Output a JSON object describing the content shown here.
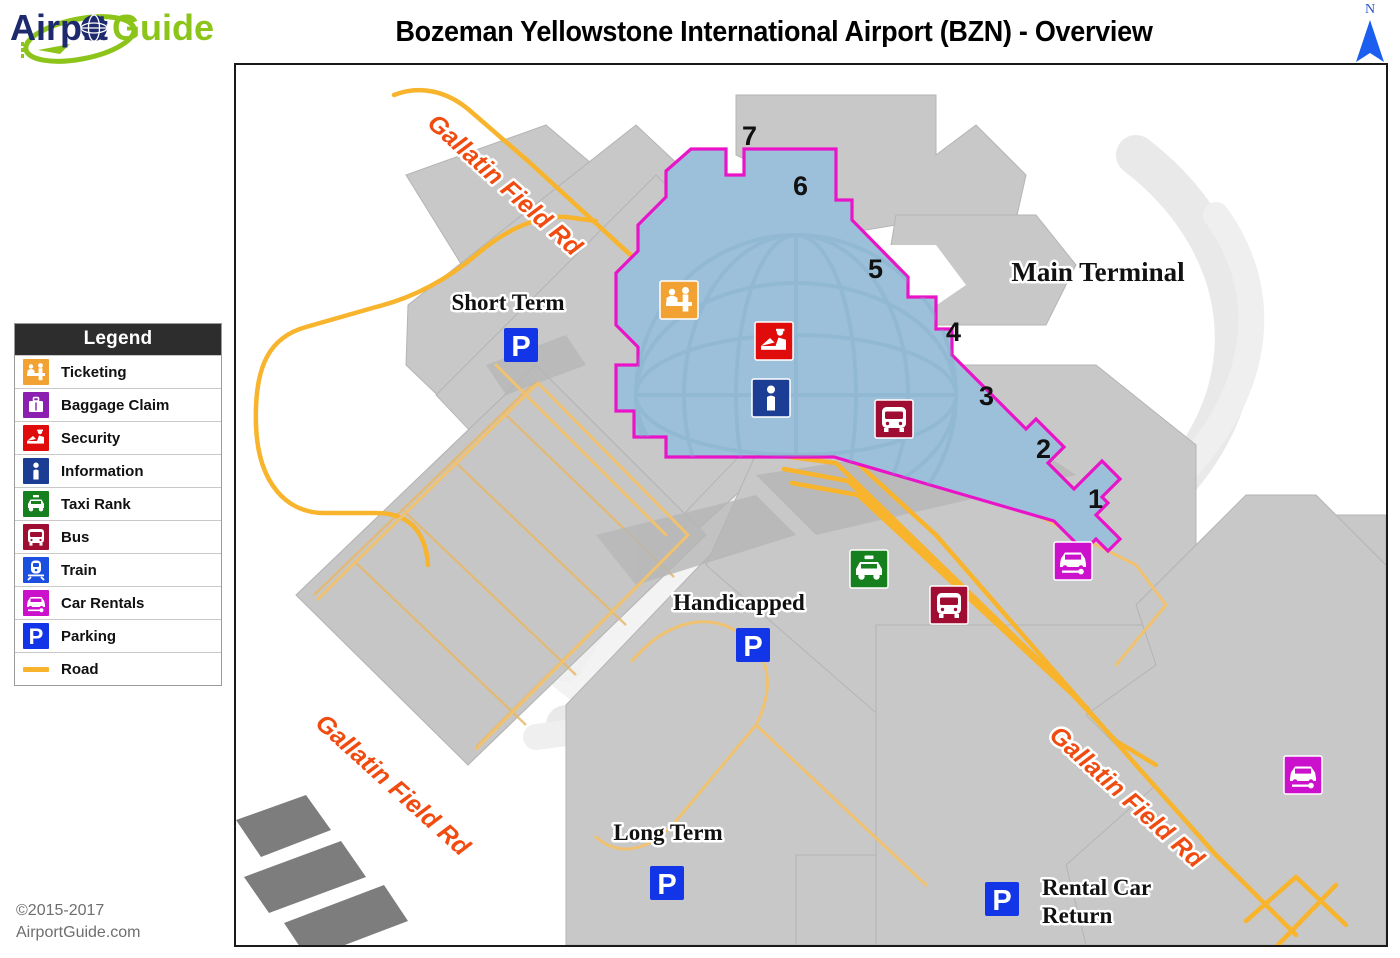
{
  "brand": {
    "name_part1": "Airport",
    "name_part2": "Guide",
    "part1_color": "#1d2b6e",
    "part2_color": "#8cc41a"
  },
  "header": {
    "title": "Bozeman Yellowstone International Airport (BZN) - Overview"
  },
  "compass": {
    "label": "N",
    "color": "#1b5ef0"
  },
  "legend": {
    "title": "Legend",
    "items": [
      {
        "icon": "ticketing-icon",
        "label": "Ticketing",
        "color": "#f2a233"
      },
      {
        "icon": "baggage-claim-icon",
        "label": "Baggage Claim",
        "color": "#8a1fb0"
      },
      {
        "icon": "security-icon",
        "label": "Security",
        "color": "#e00b0b"
      },
      {
        "icon": "information-icon",
        "label": "Information",
        "color": "#1b3e94"
      },
      {
        "icon": "taxi-rank-icon",
        "label": "Taxi Rank",
        "color": "#16801f"
      },
      {
        "icon": "bus-icon",
        "label": "Bus",
        "color": "#a00d32"
      },
      {
        "icon": "train-icon",
        "label": "Train",
        "color": "#1b4fe0"
      },
      {
        "icon": "car-rentals-icon",
        "label": "Car Rentals",
        "color": "#cc11cc"
      },
      {
        "icon": "parking-icon",
        "label": "Parking",
        "color": "#1335e8"
      },
      {
        "icon": "road-icon",
        "label": "Road",
        "color": "#f7b42c"
      }
    ]
  },
  "copyright": {
    "line1": "©2015-2017",
    "line2": "AirportGuide.com"
  },
  "map": {
    "terminal_label": "Main Terminal",
    "gate_numbers": [
      "1",
      "2",
      "3",
      "4",
      "5",
      "6",
      "7"
    ],
    "road_labels": [
      "Gallatin Field Rd",
      "Gallatin Field Rd",
      "Gallatin Field Rd"
    ],
    "parking_labels": [
      {
        "name": "Short Term",
        "icon": "parking-icon"
      },
      {
        "name": "Handicapped",
        "icon": "parking-icon"
      },
      {
        "name": "Long Term",
        "icon": "parking-icon"
      },
      {
        "name": "Rental Car Return",
        "icon": "parking-icon"
      }
    ],
    "poi_markers": [
      {
        "icon": "ticketing-icon",
        "label": "Ticketing"
      },
      {
        "icon": "security-icon",
        "label": "Security"
      },
      {
        "icon": "information-icon",
        "label": "Information"
      },
      {
        "icon": "bus-icon",
        "label": "Bus"
      },
      {
        "icon": "taxi-rank-icon",
        "label": "Taxi Rank"
      },
      {
        "icon": "bus-icon",
        "label": "Bus"
      },
      {
        "icon": "car-rentals-icon",
        "label": "Car Rentals"
      },
      {
        "icon": "car-rentals-icon",
        "label": "Car Rentals"
      }
    ],
    "colors": {
      "terminal_fill": "#9dc0da",
      "terminal_outline": "#e914c8",
      "building_fill": "#c8c8c8",
      "building_stroke": "#a8a8a8",
      "road": "#f7b42c",
      "apron": "#e4e4e4"
    }
  }
}
